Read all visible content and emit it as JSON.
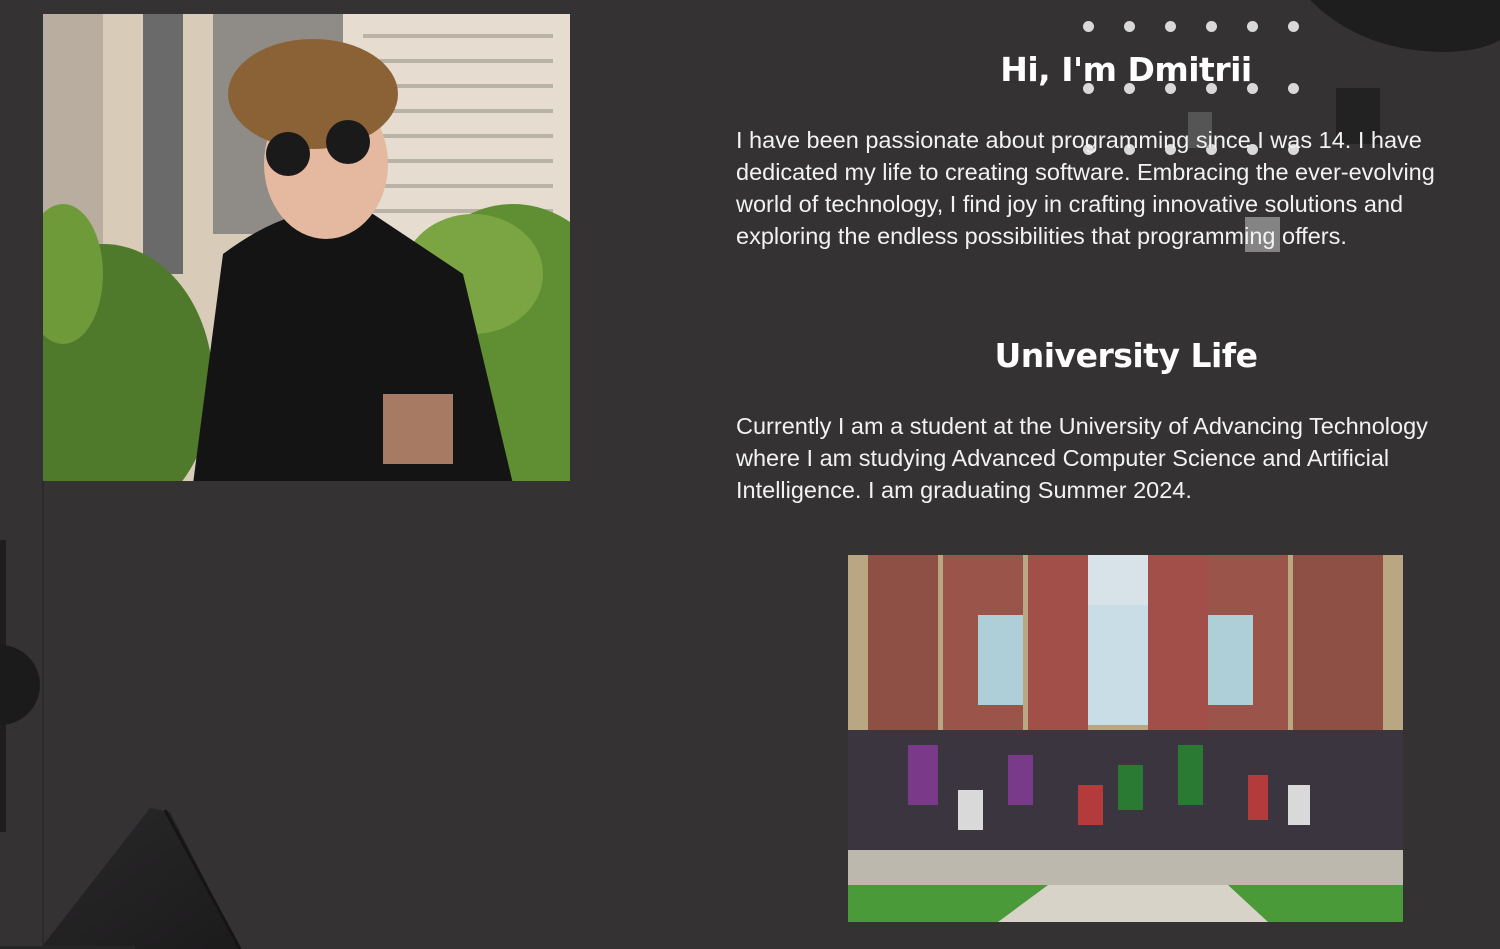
{
  "hero": {
    "title": "Hi, I'm Dmitrii",
    "bio": "I have been passionate about programming since I was 14. I have dedicated my life to creating software. Embracing the ever-evolving world of technology, I find joy in crafting innovative solutions and exploring the endless possibilities that programming offers."
  },
  "university": {
    "title": "University Life",
    "text": "Currently I am a student at the University of Advancing Technology where I am studying Advanced Computer Science and Artificial Intelligence. I am graduating Summer 2024."
  },
  "images": {
    "portrait": "portrait-photo",
    "campus": "university-group-photo"
  },
  "colors": {
    "background": "#343233",
    "text": "#ffffff",
    "dots": "#d9d9d9",
    "shapes": "#1f1e1f"
  }
}
